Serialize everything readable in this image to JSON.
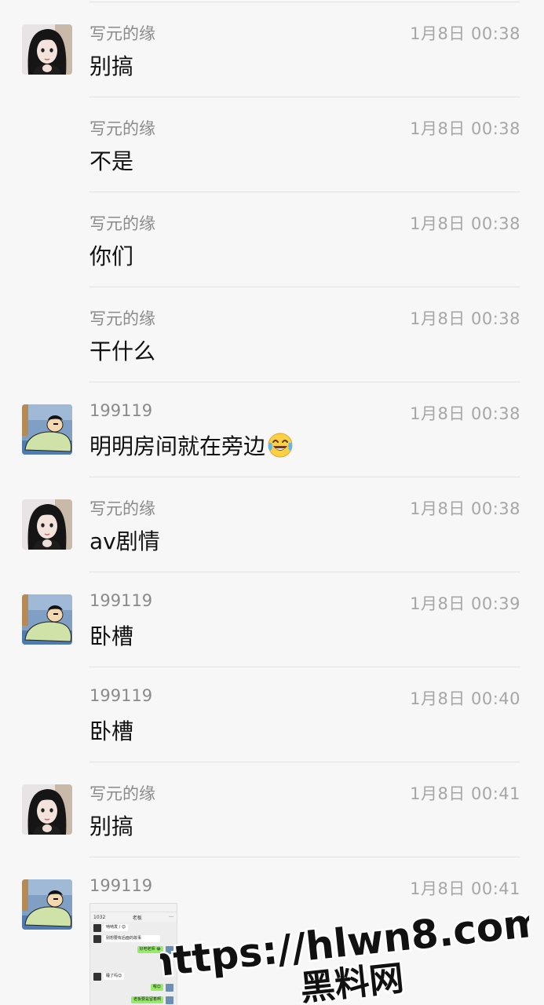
{
  "messages": [
    {
      "sender": "写元的缘",
      "time": "1月8日 00:38",
      "text": "别搞",
      "avatar": "girl"
    },
    {
      "sender": "写元的缘",
      "time": "1月8日 00:38",
      "text": "不是",
      "avatar": ""
    },
    {
      "sender": "写元的缘",
      "time": "1月8日 00:38",
      "text": "你们",
      "avatar": ""
    },
    {
      "sender": "写元的缘",
      "time": "1月8日 00:38",
      "text": "干什么",
      "avatar": ""
    },
    {
      "sender": "199119",
      "time": "1月8日 00:38",
      "text": "明明房间就在旁边",
      "avatar": "cartoon",
      "emoji": "tears-of-joy-emoji"
    },
    {
      "sender": "写元的缘",
      "time": "1月8日 00:38",
      "text": "av剧情",
      "avatar": "girl"
    },
    {
      "sender": "199119",
      "time": "1月8日 00:39",
      "text": "卧槽",
      "avatar": "cartoon"
    },
    {
      "sender": "199119",
      "time": "1月8日 00:40",
      "text": "卧槽",
      "avatar": ""
    },
    {
      "sender": "写元的缘",
      "time": "1月8日 00:41",
      "text": "别搞",
      "avatar": "girl"
    },
    {
      "sender": "199119",
      "time": "1月8日 00:41",
      "text": "",
      "avatar": "cartoon",
      "image": "chat-screenshot"
    }
  ],
  "thumbnail": {
    "back_badge": "1032",
    "title": "老板",
    "bubbles": [
      "呐呐发 / 😊",
      "别想要有后面的故事",
      "好吧老师 😂",
      "睡了吗😊",
      "嗯😊",
      "老板要是留着啊"
    ]
  },
  "watermark": {
    "line1": "https://hlwn8.com",
    "line2": "黑料网"
  },
  "colors": {
    "background": "#f7f7f7",
    "sender": "#8a8a8a",
    "time": "#a6a6a6",
    "text": "#111111",
    "divider": "#e2e2e2",
    "bubble_green": "#95ec69"
  }
}
